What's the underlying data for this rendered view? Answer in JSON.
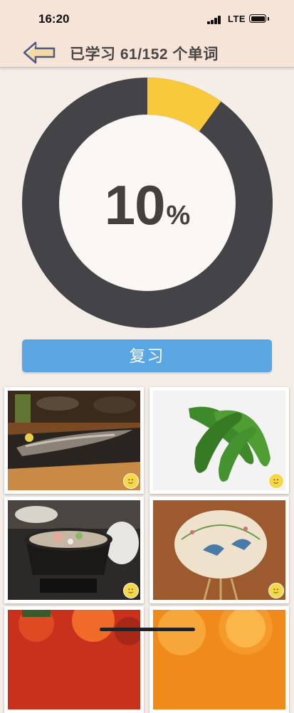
{
  "status_bar": {
    "time": "16:20",
    "network": "LTE",
    "icons": [
      "signal-bars-icon",
      "battery-icon"
    ]
  },
  "header": {
    "title": "已学习 61/152 个单词",
    "back_icon": "left-arrow-icon"
  },
  "progress": {
    "value": "10",
    "unit": "%",
    "learned": 61,
    "total": 152,
    "fraction": 0.1,
    "colors": {
      "filled": "#f9c93c",
      "track": "#444347",
      "center": "#faf7f5"
    }
  },
  "actions": {
    "review_label": "复习"
  },
  "words": [
    {
      "subject": "grilled fish",
      "badge": "smiley-icon"
    },
    {
      "subject": "bitter melon",
      "badge": "smiley-icon"
    },
    {
      "subject": "hot pot",
      "badge": "smiley-icon"
    },
    {
      "subject": "uchiwa fan",
      "badge": "smiley-icon"
    },
    {
      "subject": "maple leaves",
      "badge": "smiley-icon"
    },
    {
      "subject": "orange slices",
      "badge": "smiley-icon"
    }
  ],
  "colors": {
    "background": "#f4ede8",
    "header_bg": "#f6e4d9",
    "button_blue": "#5aa6e3",
    "badge_yellow": "#f7d74a"
  }
}
